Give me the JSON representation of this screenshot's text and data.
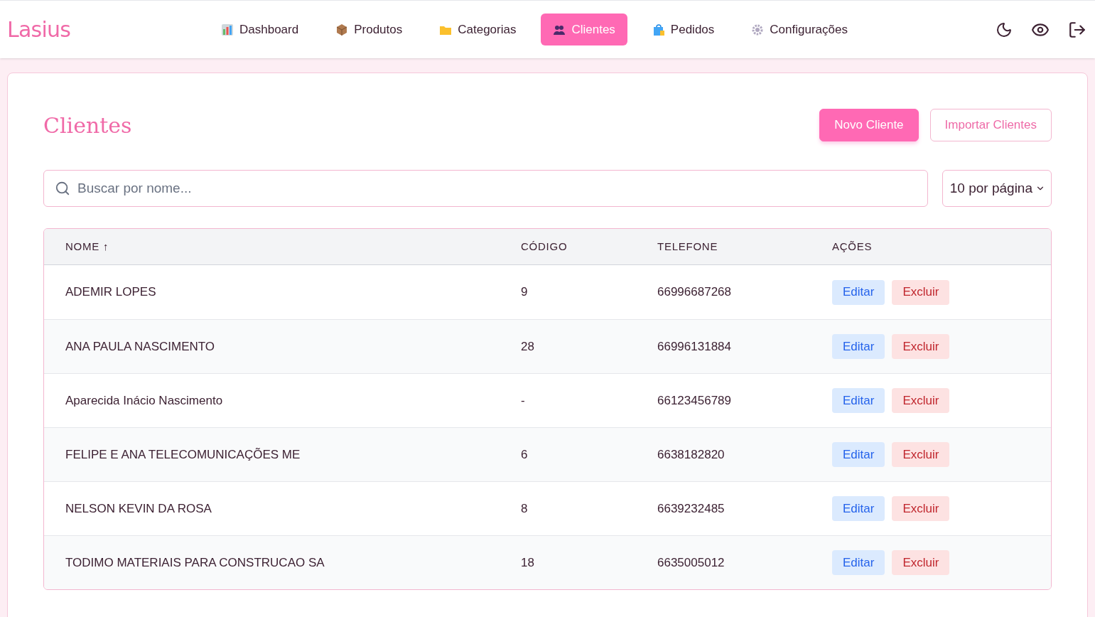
{
  "logo": {
    "text": "Lasius"
  },
  "nav": [
    {
      "label": "Dashboard",
      "selected": false
    },
    {
      "label": "Produtos",
      "selected": false
    },
    {
      "label": "Categorias",
      "selected": false
    },
    {
      "label": "Clientes",
      "selected": true
    },
    {
      "label": "Pedidos",
      "selected": false
    },
    {
      "label": "Configurações",
      "selected": false
    }
  ],
  "page": {
    "title": "Clientes",
    "buttons": [
      {
        "label": "Novo Cliente",
        "kind": "primary"
      },
      {
        "label": "Importar Clientes",
        "kind": "outline"
      }
    ]
  },
  "search": {
    "placeholder": "Buscar por nome..."
  },
  "page_size": {
    "value": "10 por página"
  },
  "table": {
    "columns": [
      {
        "label": "NOME ↑"
      },
      {
        "label": "CÓDIGO"
      },
      {
        "label": "TELEFONE"
      },
      {
        "label": "AÇÕES"
      }
    ],
    "rows": [
      {
        "nome": "ADEMIR LOPES",
        "codigo": "9",
        "telefone": "66996687268",
        "actions": [
          "Editar",
          "Excluir"
        ]
      },
      {
        "nome": "ANA PAULA NASCIMENTO",
        "codigo": "28",
        "telefone": "66996131884",
        "actions": [
          "Editar",
          "Excluir"
        ]
      },
      {
        "nome": "Aparecida Inácio Nascimento",
        "codigo": "-",
        "telefone": "66123456789",
        "actions": [
          "Editar",
          "Excluir"
        ]
      },
      {
        "nome": "FELIPE E ANA TELECOMUNICAÇÕES ME",
        "codigo": "6",
        "telefone": "6638182820",
        "actions": [
          "Editar",
          "Excluir"
        ]
      },
      {
        "nome": "NELSON KEVIN DA ROSA",
        "codigo": "8",
        "telefone": "6639232485",
        "actions": [
          "Editar",
          "Excluir"
        ]
      },
      {
        "nome": "TODIMO MATERIAIS PARA CONSTRUCAO SA",
        "codigo": "18",
        "telefone": "6635005012",
        "actions": [
          "Editar",
          "Excluir"
        ]
      }
    ]
  }
}
